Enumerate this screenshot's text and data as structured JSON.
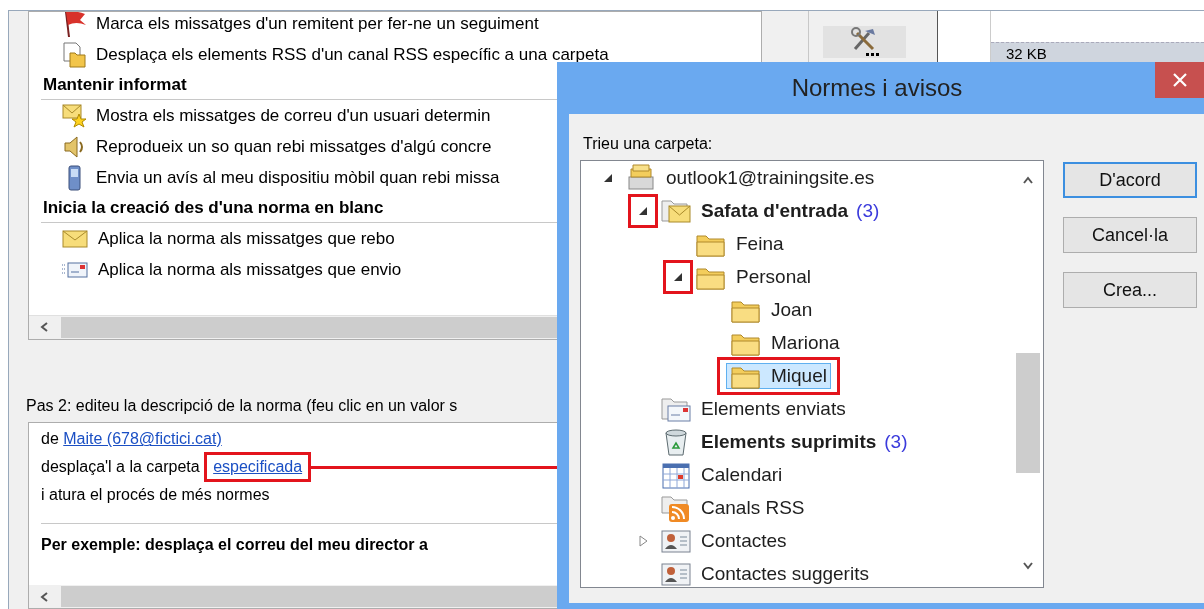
{
  "background": {
    "rules": [
      {
        "kind": "flag",
        "text": "Marca els missatges d'un remitent per fer-ne un seguiment"
      },
      {
        "kind": "rss-move",
        "text": "Desplaça els elements RSS d'un canal RSS específic a una carpeta"
      },
      {
        "kind": "heading",
        "text": "Mantenir informat"
      },
      {
        "kind": "star-mail",
        "text": "Mostra els missatges de correu d'un usuari determin"
      },
      {
        "kind": "sound",
        "text": "Reprodueix un so quan rebi missatges d'algú concre"
      },
      {
        "kind": "mobile",
        "text": "Envia un avís al meu dispositiu mòbil quan rebi missa"
      },
      {
        "kind": "heading",
        "text": "Inicia la creació des d'una norma en blanc"
      },
      {
        "kind": "mail-in",
        "text": "Aplica la norma als missatges que rebo"
      },
      {
        "kind": "mail-out",
        "text": "Aplica la norma als missatges que envio"
      }
    ],
    "step_label": "Pas 2: editeu la descripció de la norma (feu clic en un valor s",
    "description": {
      "lines": [
        {
          "parts": [
            {
              "text": "de "
            },
            {
              "text": "Maite (678@fictici.cat)",
              "link": true,
              "marked": false
            }
          ]
        },
        {
          "parts": [
            {
              "text": "desplaça'l a la carpeta "
            },
            {
              "text": "especificada",
              "link": true,
              "marked": true
            }
          ]
        },
        {
          "parts": [
            {
              "text": "i atura el procés de més normes"
            }
          ]
        }
      ],
      "example": "Per exemple: desplaça el correu del meu director a"
    },
    "size_label": "32 KB"
  },
  "dialog": {
    "title": "Normes i avisos",
    "prompt": "Trieu una carpeta:",
    "tree": {
      "items": [
        {
          "label": "outlook1@trainingsite.es",
          "kind": "account",
          "bold": false,
          "expanded": true,
          "expander_marked": false,
          "selected": false,
          "marked": false,
          "children": [
            {
              "label": "Safata d'entrada",
              "kind": "inbox",
              "bold": true,
              "count": "(3)",
              "expanded": true,
              "expander_marked": true,
              "selected": false,
              "marked": false,
              "children": [
                {
                  "label": "Feina",
                  "kind": "folder",
                  "bold": false,
                  "selected": false,
                  "marked": false
                },
                {
                  "label": "Personal",
                  "kind": "folder",
                  "bold": false,
                  "expanded": true,
                  "expander_marked": true,
                  "selected": false,
                  "marked": false,
                  "children": [
                    {
                      "label": "Joan",
                      "kind": "folder",
                      "bold": false,
                      "selected": false,
                      "marked": false
                    },
                    {
                      "label": "Mariona",
                      "kind": "folder",
                      "bold": false,
                      "selected": false,
                      "marked": false
                    },
                    {
                      "label": "Miquel",
                      "kind": "folder",
                      "bold": false,
                      "selected": true,
                      "marked": true
                    }
                  ]
                }
              ]
            },
            {
              "label": "Elements enviats",
              "kind": "sent",
              "bold": false,
              "selected": false,
              "marked": false
            },
            {
              "label": "Elements suprimits",
              "kind": "trash",
              "bold": true,
              "count": "(3)",
              "selected": false,
              "marked": false
            },
            {
              "label": "Calendari",
              "kind": "calendar",
              "bold": false,
              "selected": false,
              "marked": false
            },
            {
              "label": "Canals RSS",
              "kind": "rss",
              "bold": false,
              "selected": false,
              "marked": false
            },
            {
              "label": "Contactes",
              "kind": "contacts",
              "bold": false,
              "expanded": false,
              "expander_marked": false,
              "selected": false,
              "marked": false
            },
            {
              "label": "Contactes suggerits",
              "kind": "contacts",
              "bold": false,
              "selected": false,
              "marked": false
            }
          ]
        }
      ]
    },
    "buttons": [
      {
        "label": "D'acord",
        "default": true
      },
      {
        "label": "Cancel·la",
        "default": false
      },
      {
        "label": "Crea...",
        "default": false
      }
    ]
  }
}
